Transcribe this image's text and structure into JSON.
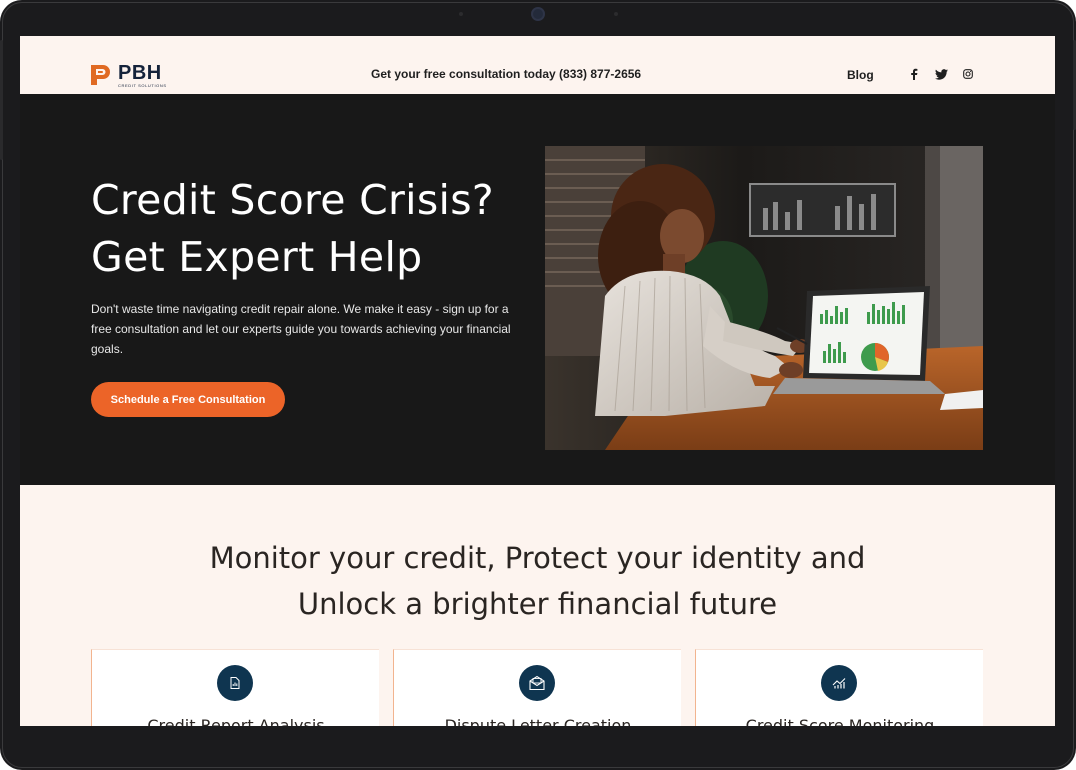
{
  "header": {
    "logo_name": "PBH",
    "logo_sub": "CREDIT SOLUTIONS",
    "consultation": "Get your free consultation today (833) 877-2656",
    "blog_label": "Blog",
    "social_icons": [
      "facebook-icon",
      "twitter-icon",
      "instagram-icon"
    ]
  },
  "hero": {
    "title_line1": "Credit Score Crisis?",
    "title_line2": "Get Expert Help",
    "description": "Don't waste time navigating credit repair alone. We make it easy - sign up for a free consultation and let our experts guide you towards achieving your financial goals.",
    "cta_label": "Schedule a Free Consultation"
  },
  "section": {
    "title_line1": "Monitor your credit, Protect your identity and",
    "title_line2": "Unlock a brighter financial future",
    "cards": [
      {
        "title": "Credit Report Analysis",
        "icon": "report-icon"
      },
      {
        "title": "Dispute Letter Creation",
        "icon": "envelope-icon"
      },
      {
        "title": "Credit Score Monitoring",
        "icon": "chart-icon"
      }
    ]
  },
  "colors": {
    "accent": "#ec6428",
    "navy": "#0f3550",
    "hero_bg": "#181818",
    "page_bg": "#fdf4ef"
  }
}
